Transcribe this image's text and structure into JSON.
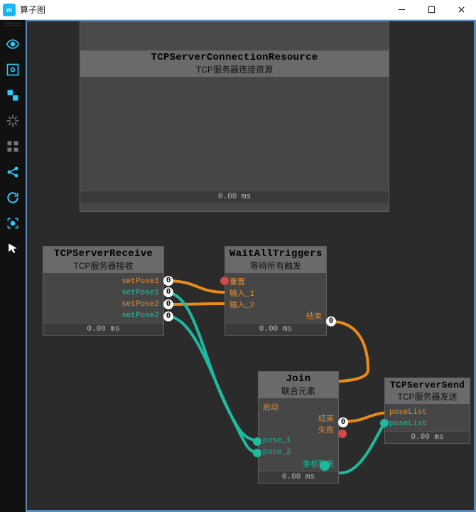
{
  "window": {
    "title": "算子图",
    "minimize": "−",
    "maximize": "□",
    "close": "×"
  },
  "sidebar": {
    "tools": [
      {
        "name": "drag-handle"
      },
      {
        "name": "eye-icon"
      },
      {
        "name": "detect-icon"
      },
      {
        "name": "link-icon"
      },
      {
        "name": "snap-icon"
      },
      {
        "name": "grid-icon"
      },
      {
        "name": "share-icon"
      },
      {
        "name": "refresh-icon"
      },
      {
        "name": "capture-icon"
      },
      {
        "name": "cursor-icon"
      }
    ]
  },
  "nodes": {
    "resource": {
      "title": "TCPServerConnectionResource",
      "subtitle": "TCP服务器连接资源",
      "timing": "0.00 ms"
    },
    "receive": {
      "title": "TCPServerReceive",
      "subtitle": "TCP服务器接收",
      "timing": "0.00 ms",
      "out": [
        "setPose1",
        "setPose1",
        "setPose2",
        "setPose2"
      ]
    },
    "wait": {
      "title": "WaitAllTriggers",
      "subtitle": "等待所有触发",
      "timing": "0.00 ms",
      "in": [
        "重置",
        "输入_1",
        "输入_2"
      ],
      "out": [
        "结束"
      ]
    },
    "join": {
      "title": "Join",
      "subtitle": "联合元素",
      "timing": "0.00 ms",
      "in_start": "启动",
      "out_end": "结束",
      "out_fail": "失败",
      "in_pose1": "pose_1",
      "in_pose2": "pose_2",
      "out_list": "坐标列表"
    },
    "send": {
      "title": "TCPServerSend",
      "subtitle": "TCP服务器发送",
      "timing": "0.00 ms",
      "in": [
        "poseList",
        "poseList"
      ]
    }
  },
  "port_zero": "0"
}
